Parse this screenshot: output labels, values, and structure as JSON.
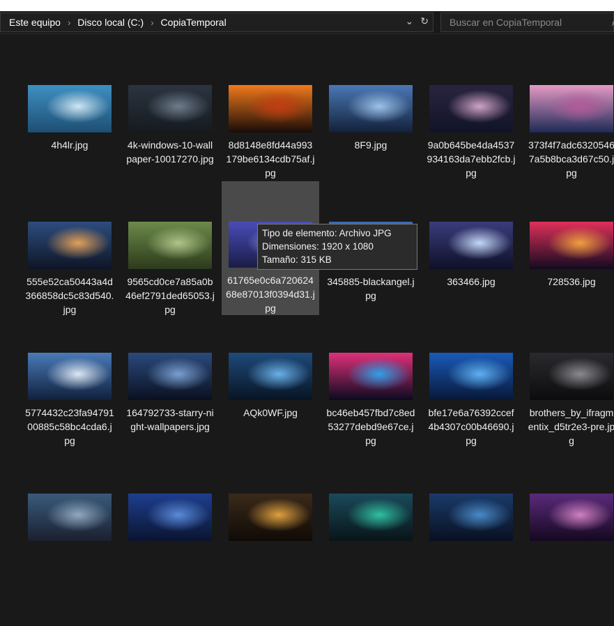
{
  "breadcrumb": [
    "Este equipo",
    "Disco local (C:)",
    "CopiaTemporal"
  ],
  "search": {
    "placeholder": "Buscar en CopiaTemporal"
  },
  "files": [
    {
      "name": "4h4lr.jpg",
      "colors": [
        "#3e8fc2",
        "#cfe6f3",
        "#1d4f73"
      ]
    },
    {
      "name": "4k-windows-10-wallpaper-10017270.jpg",
      "colors": [
        "#2b3440",
        "#6f7d8c",
        "#151a1f"
      ]
    },
    {
      "name": "8d8148e8fd44a993179be6134cdb75af.jpg",
      "colors": [
        "#f07a1c",
        "#c43c12",
        "#1a0c08"
      ]
    },
    {
      "name": "8F9.jpg",
      "colors": [
        "#4a78b6",
        "#9cc2e8",
        "#13213a"
      ]
    },
    {
      "name": "9a0b645be4da4537934163da7ebb2fcb.jpg",
      "colors": [
        "#2a2340",
        "#d0a3c8",
        "#101428"
      ]
    },
    {
      "name": "373f4f7adc63205467a5b8bca3d67c50.jpg",
      "colors": [
        "#e49ac4",
        "#b25a9a",
        "#1d2a56"
      ]
    },
    {
      "name": "555e52ca50443a4d366858dc5c83d540.jpg",
      "colors": [
        "#2d4d7e",
        "#e3a05a",
        "#0e1526"
      ]
    },
    {
      "name": "9565cd0ce7a85a0b46ef2791ded65053.jpg",
      "colors": [
        "#6c8a4a",
        "#b0c48a",
        "#2c3a1c"
      ]
    },
    {
      "name": "61765e0c6a72062468e87013f0394d31.jpg",
      "colors": [
        "#4a4cb8",
        "#8aa0e6",
        "#1a1c46"
      ]
    },
    {
      "name": "345885-blackangel.jpg",
      "colors": [
        "#3a6ab8",
        "#b8d4f0",
        "#12203e"
      ]
    },
    {
      "name": "363466.jpg",
      "colors": [
        "#3a3c7c",
        "#c4d8f8",
        "#0f1028"
      ]
    },
    {
      "name": "728536.jpg",
      "colors": [
        "#e0305a",
        "#f0a040",
        "#120a20"
      ]
    },
    {
      "name": "5774432c23fa9479100885c58bc4cda6.jpg",
      "colors": [
        "#4a7ab8",
        "#dce8f4",
        "#10203c"
      ]
    },
    {
      "name": "164792733-starry-night-wallpapers.jpg",
      "colors": [
        "#2a4a7c",
        "#7aa0d0",
        "#0a1020"
      ]
    },
    {
      "name": "AQk0WF.jpg",
      "colors": [
        "#1e4a7a",
        "#6ab0e8",
        "#081424"
      ]
    },
    {
      "name": "bc46eb457fbd7c8ed53277debd9e67ce.jpg",
      "colors": [
        "#e0307a",
        "#30a0e8",
        "#0a0a20"
      ]
    },
    {
      "name": "bfe17e6a76392ccef4b4307c00b46690.jpg",
      "colors": [
        "#1a5ab8",
        "#60b0f0",
        "#081838"
      ]
    },
    {
      "name": "brothers_by_ifragmentix_d5tr2e3-pre.jpg",
      "colors": [
        "#2a2a2e",
        "#8a8a90",
        "#0c0c0e"
      ]
    },
    {
      "name": "",
      "colors": [
        "#3a5a7a",
        "#90a8c0",
        "#1a2030"
      ]
    },
    {
      "name": "",
      "colors": [
        "#1e3e8e",
        "#5a8ad8",
        "#0a1430"
      ]
    },
    {
      "name": "",
      "colors": [
        "#3a2a1a",
        "#e0a040",
        "#100a06"
      ]
    },
    {
      "name": "",
      "colors": [
        "#1a4a5a",
        "#30c0a0",
        "#081418"
      ]
    },
    {
      "name": "",
      "colors": [
        "#1a3a6a",
        "#4a8ac8",
        "#081020"
      ]
    },
    {
      "name": "",
      "colors": [
        "#5a2a7a",
        "#d080c0",
        "#140820"
      ]
    }
  ],
  "tooltip": {
    "line1": "Tipo de elemento: Archivo JPG",
    "line2": "Dimensiones: 1920 x 1080",
    "line3": "Tamaño: 315 KB"
  },
  "icons": {
    "dropdown": "chevron-down-icon",
    "refresh": "refresh-icon",
    "search": "search-icon"
  }
}
